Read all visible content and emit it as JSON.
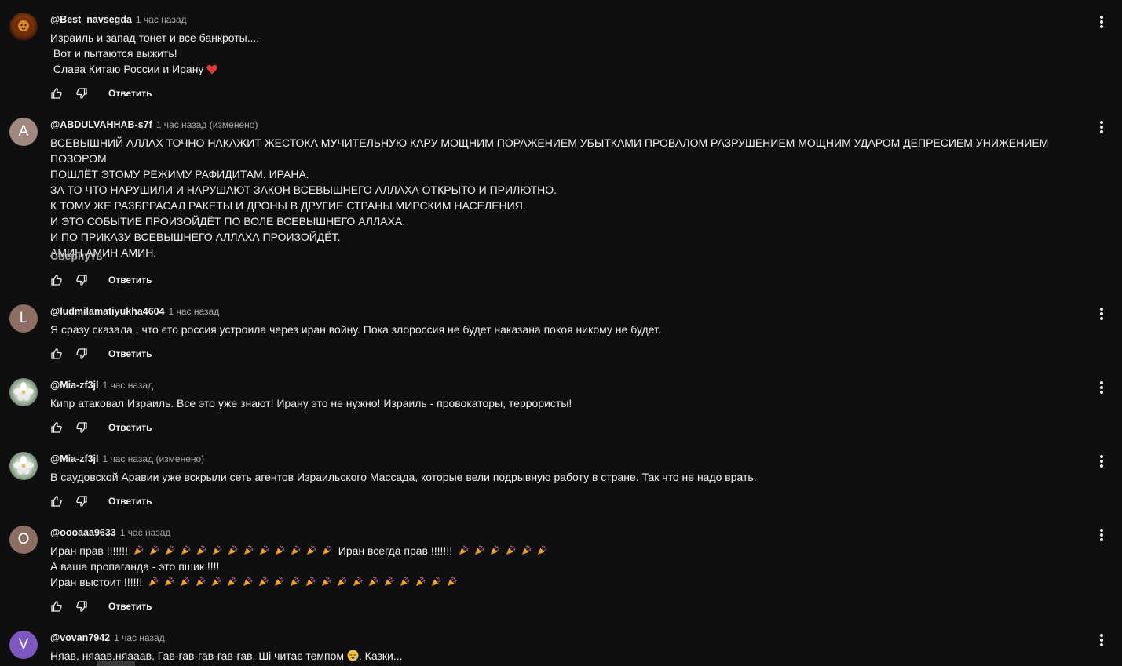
{
  "comments": [
    {
      "author": "@Best_navsegda",
      "time": "1 час назад",
      "avatar_icon": "lion-avatar-image",
      "lines": [
        "Израиль и запад тонет и все банкроты....",
        " Вот и пытаются выжить!",
        " Слава Китаю России и Ирану"
      ],
      "reply_label": "Ответить"
    },
    {
      "author": "@ABDULVAHHAB-s7f",
      "time": "1 час назад (изменено)",
      "avatar_letter": "A",
      "lines": [
        "ВСЕВЫШНИЙ АЛЛАХ ТОЧНО НАКАЖИТ ЖЕСТОКА МУЧИТЕЛЬНУЮ КАРУ МОЩНИМ ПОРАЖЕНИЕМ УБЫТКАМИ ПРОВАЛОМ РАЗРУШЕНИЕМ МОЩНИМ УДАРОМ ДЕПРЕСИЕМ УНИЖЕНИЕМ ПОЗОРОМ",
        "ПОШЛЁТ ЭТОМУ РЕЖИМУ РАФИДИТАМ. ИРАНА.",
        "ЗА ТО ЧТО НАРУШИЛИ И НАРУШАЮТ ЗАКОН ВСЕВЫШНЕГО АЛЛАХА ОТКРЫТО И ПРИЛЮТНО.",
        "К ТОМУ ЖЕ РАЗБРРАСАЛ РАКЕТЫ И ДРОНЫ В ДРУГИЕ СТРАНЫ МИРСКИМ НАСЕЛЕНИЯ.",
        "И ЭТО СОБЫТИЕ ПРОИЗОЙДЁТ ПО ВОЛЕ ВСЕВЫШНЕГО АЛЛАХА.",
        "И ПО ПРИКАЗУ ВСЕВЫШНЕГО АЛЛАХА ПРОИЗОЙДЁТ.",
        "АМИН АМИН АМИН."
      ],
      "collapse_label": "Свернуть",
      "reply_label": "Ответить"
    },
    {
      "author": "@ludmilamatiyukha4604",
      "time": "1 час назад",
      "avatar_letter": "L",
      "lines": [
        "Я сразу сказала , что єто россия устроила через иран войну. Пока злороссия не будет наказана покоя никому не будет."
      ],
      "reply_label": "Ответить"
    },
    {
      "author": "@Mia-zf3jl",
      "time": "1 час назад",
      "avatar_icon": "flower-avatar-image",
      "lines": [
        "Кипр атаковал Израиль. Все это уже знают! Ирану это не нужно! Израиль - провокаторы, террористы!"
      ],
      "reply_label": "Ответить"
    },
    {
      "author": "@Mia-zf3jl",
      "time": "1 час назад (изменено)",
      "avatar_icon": "flower-avatar-image",
      "lines": [
        "В саудовской Аравии уже вскрыли сеть агентов Израильского Массада, которые вели подрывную работу в стране. Так что не надо врать."
      ],
      "reply_label": "Ответить"
    },
    {
      "author": "@oooaaa9633",
      "time": "1 час назад",
      "avatar_letter": "O",
      "line1_a": "Иран прав !!!!!!!",
      "line1_b": "Иран всегда прав !!!!!!!",
      "line2": "А ваша пропаганда - это пшик !!!!",
      "line3": "Иран выстоит !!!!!!",
      "emoji_icon": "party-popper-icon",
      "reply_label": "Ответить"
    },
    {
      "author": "@vovan7942",
      "time": "1 час назад",
      "avatar_letter": "V",
      "line_a": "Няав. няаав.няааав. Гав-гав-гав-гав-гав. Ші читає темпом",
      "line_b": ". Казки...",
      "emoji_icon": "sleepy-face-icon"
    }
  ],
  "icons": {
    "like": "thumbs-up-icon",
    "dislike": "thumbs-down-icon",
    "menu": "more-vertical-icon",
    "heart": "red-heart-icon"
  },
  "colors": {
    "background": "#0f0f0f",
    "text": "#f1f1f1",
    "secondary_text": "#aaaaaa",
    "avatar_v": "#7e57c2",
    "avatar_brown": "#8d6e63",
    "heart": "#e53935"
  }
}
